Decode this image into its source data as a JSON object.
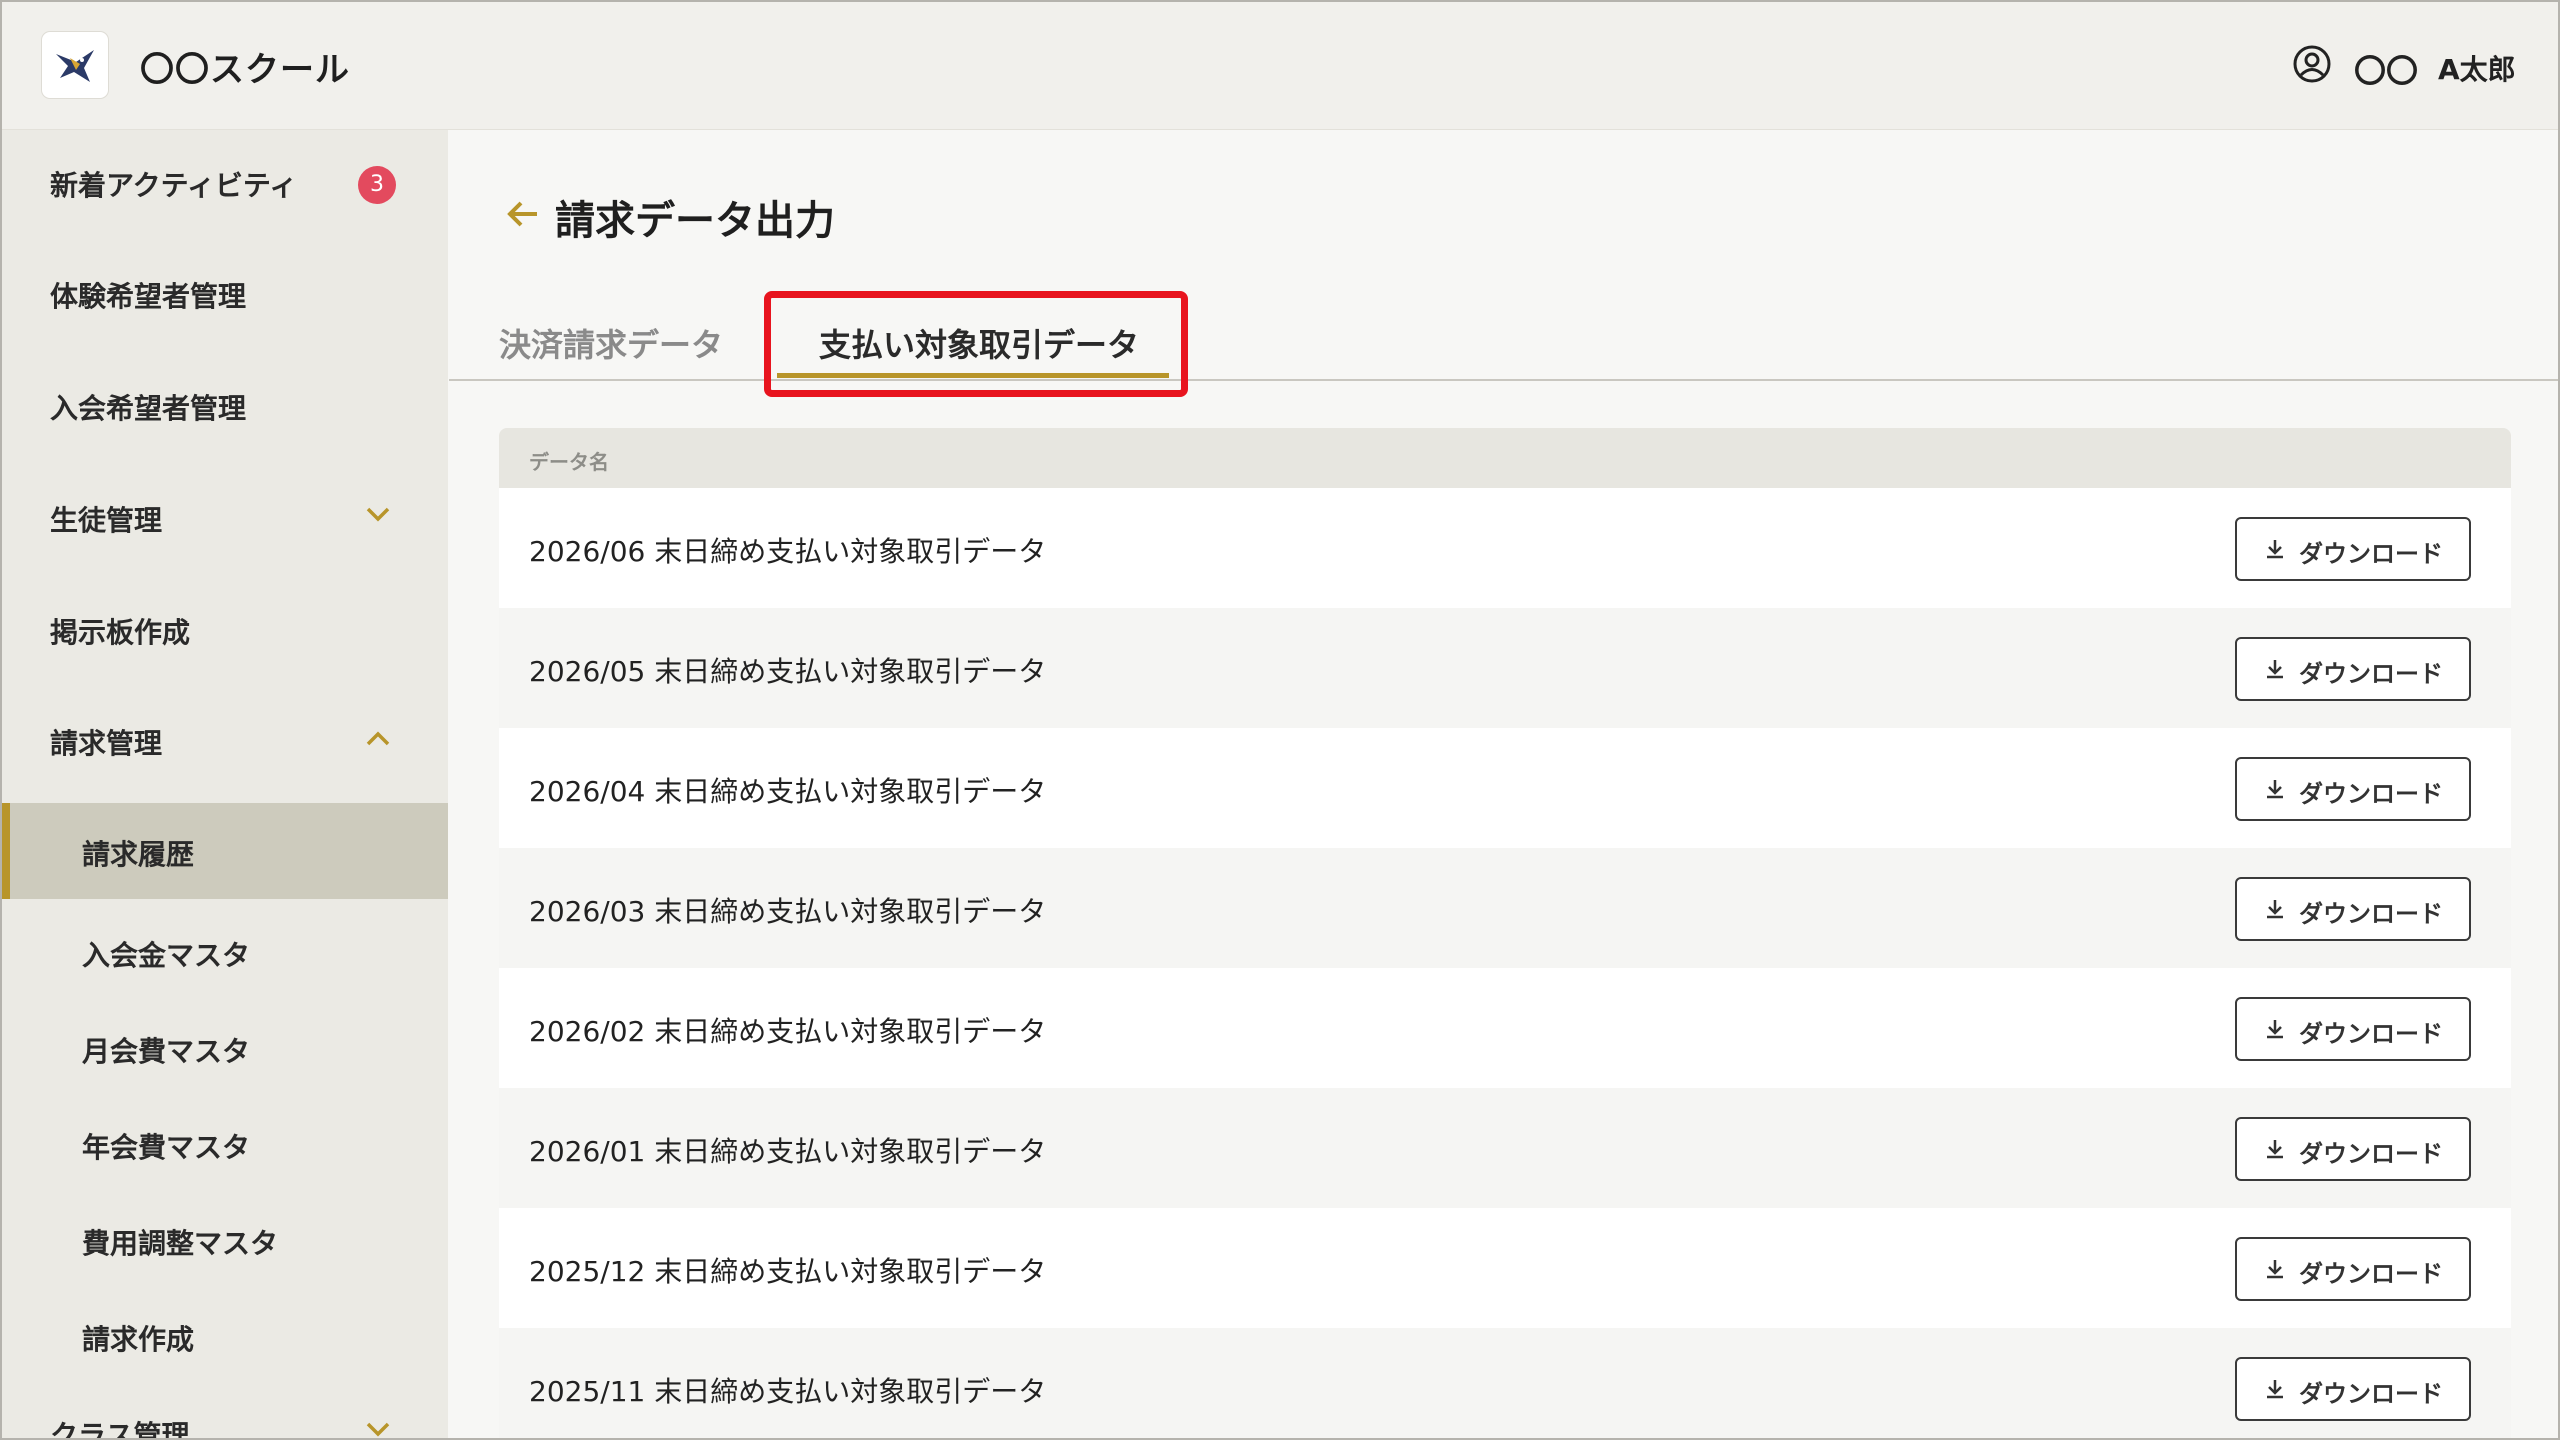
{
  "header": {
    "app_title": "〇〇スクール",
    "user_org": "〇〇",
    "user_name": "A太郎"
  },
  "sidebar": {
    "items": [
      {
        "label": "新着アクティビティ",
        "badge": "3"
      },
      {
        "label": "体験希望者管理"
      },
      {
        "label": "入会希望者管理"
      },
      {
        "label": "生徒管理",
        "expanded": false
      },
      {
        "label": "掲示板作成"
      },
      {
        "label": "請求管理",
        "expanded": true
      },
      {
        "label": "請求履歴",
        "active": true
      },
      {
        "label": "入会金マスタ"
      },
      {
        "label": "月会費マスタ"
      },
      {
        "label": "年会費マスタ"
      },
      {
        "label": "費用調整マスタ"
      },
      {
        "label": "請求作成"
      },
      {
        "label": "クラス管理",
        "expanded": false
      }
    ]
  },
  "main": {
    "title": "請求データ出力",
    "tabs": [
      {
        "label": "決済請求データ",
        "selected": false
      },
      {
        "label": "支払い対象取引データ",
        "selected": true
      }
    ],
    "table": {
      "header": "データ名",
      "download_label": "ダウンロード",
      "rows": [
        "2026/06 末日締め支払い対象取引データ",
        "2026/05 末日締め支払い対象取引データ",
        "2026/04 末日締め支払い対象取引データ",
        "2026/03 末日締め支払い対象取引データ",
        "2026/02 末日締め支払い対象取引データ",
        "2026/01 末日締め支払い対象取引データ",
        "2025/12 末日締め支払い対象取引データ",
        "2025/11 末日締め支払い対象取引データ"
      ]
    }
  },
  "colors": {
    "accent": "#b8952a",
    "badge": "#e34a5e",
    "highlight": "#e8141e"
  }
}
